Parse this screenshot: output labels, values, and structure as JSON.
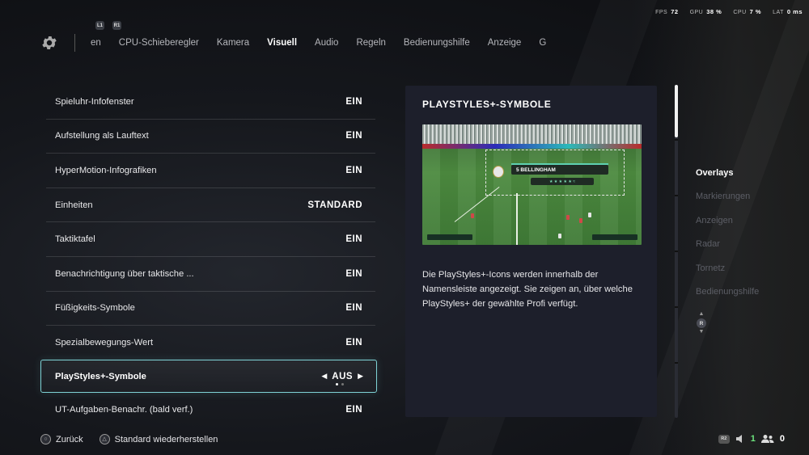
{
  "perf": {
    "fps_label": "FPS",
    "fps_value": "72",
    "gpu_label": "GPU",
    "gpu_value": "38 %",
    "cpu_label": "CPU",
    "cpu_value": "7 %",
    "lat_label": "LAT",
    "lat_value": "0 ms"
  },
  "nav": {
    "left_shoulder": "L1",
    "right_shoulder": "R1",
    "tabs": [
      "en",
      "CPU-Schieberegler",
      "Kamera",
      "Visuell",
      "Audio",
      "Regeln",
      "Bedienungshilfe",
      "Anzeige",
      "G"
    ],
    "active_tab": "Visuell"
  },
  "settings": [
    {
      "label": "Spieluhr-Infofenster",
      "value": "EIN"
    },
    {
      "label": "Aufstellung als Lauftext",
      "value": "EIN"
    },
    {
      "label": "HyperMotion-Infografiken",
      "value": "EIN"
    },
    {
      "label": "Einheiten",
      "value": "STANDARD"
    },
    {
      "label": "Taktiktafel",
      "value": "EIN"
    },
    {
      "label": "Benachrichtigung über taktische ...",
      "value": "EIN"
    },
    {
      "label": "Füßigkeits-Symbole",
      "value": "EIN"
    },
    {
      "label": "Spezialbewegungs-Wert",
      "value": "EIN"
    },
    {
      "label": "PlayStyles+-Symbole",
      "value": "AUS",
      "selected": true,
      "option_index": 1,
      "option_count": 2
    },
    {
      "label": "UT-Aufgaben-Benachr. (bald verf.)",
      "value": "EIN"
    }
  ],
  "panel": {
    "title": "PLAYSTYLES+-SYMBOLE",
    "preview": {
      "player_name": "5 BELLINGHAM"
    },
    "description": "Die PlayStyles+-Icons werden innerhalb der Namensleiste angezeigt. Sie zeigen an, über welche PlayStyles+ der gewählte Profi verfügt."
  },
  "sections": {
    "items": [
      "Overlays",
      "Markierungen",
      "Anzeigen",
      "Radar",
      "Tornetz",
      "Bedienungshilfe"
    ],
    "active": "Overlays",
    "scroll_button": "R"
  },
  "footer": {
    "back_label": "Zurück",
    "reset_label": "Standard wiederherstellen",
    "r2_label": "R2",
    "voice_count": "1",
    "party_count": "0"
  },
  "colors": {
    "accent": "#7fd3d6",
    "panel_bg": "#1d1f2b",
    "online_green": "#6de57e"
  }
}
